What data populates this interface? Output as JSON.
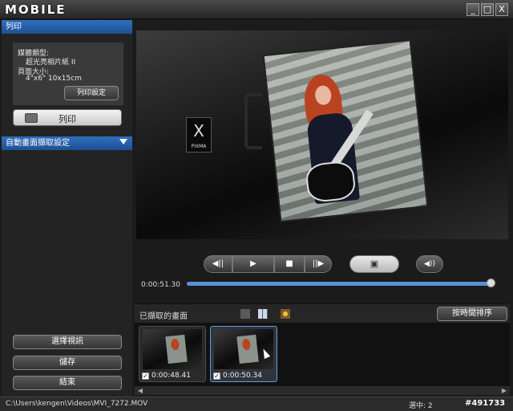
{
  "window": {
    "logo": "MOBILE",
    "controls": {
      "minimize": "_",
      "maximize": "□",
      "close": "X"
    }
  },
  "left_panel": {
    "print_header": "列印",
    "media_type_label": "媒體類型:",
    "media_type_value": "超光亮相片紙 II",
    "page_size_label": "頁面大小:",
    "page_size_value": "4\"x6\" 10x15cm",
    "print_settings_button": "列印設定",
    "print_button": "列印",
    "auto_capture_header": "自動畫面擷取設定",
    "select_video_button": "選擇視訊",
    "save_button": "儲存",
    "exit_button": "結束"
  },
  "player": {
    "brand_mark": "X",
    "brand_text": "PIXMA",
    "current_time": "0:00:51.30",
    "progress": 0.99,
    "buttons": {
      "prev_frame": "◀||",
      "play": "▶",
      "stop": "■",
      "next_frame": "||▶",
      "capture": "▣",
      "volume": "◀))"
    }
  },
  "captures": {
    "title": "已擷取的畫面",
    "sort_button": "按時間排序",
    "items": [
      {
        "time": "0:00:48.41",
        "checked": true,
        "selected": false
      },
      {
        "time": "0:00:50.34",
        "checked": true,
        "selected": true
      }
    ]
  },
  "status": {
    "path": "C:\\Users\\kengen\\Videos\\MVI_7272.MOV",
    "selected_count": "選中: 2",
    "watermark": "#491733"
  }
}
